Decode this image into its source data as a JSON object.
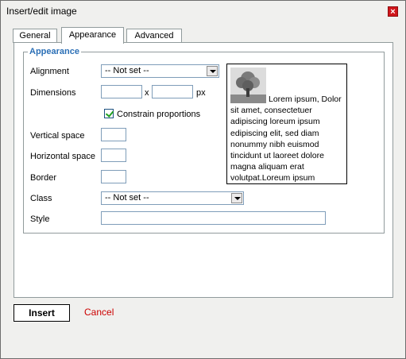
{
  "window": {
    "title": "Insert/edit image",
    "close_label": "×"
  },
  "tabs": [
    {
      "label": "General"
    },
    {
      "label": "Appearance"
    },
    {
      "label": "Advanced"
    }
  ],
  "appearance": {
    "legend": "Appearance",
    "alignment": {
      "label": "Alignment",
      "value": "-- Not set --"
    },
    "dimensions": {
      "label": "Dimensions",
      "width": "",
      "height": "",
      "separator": "x",
      "unit": "px"
    },
    "constrain": {
      "label": "Constrain proportions",
      "checked": true
    },
    "vspace": {
      "label": "Vertical space",
      "value": ""
    },
    "hspace": {
      "label": "Horizontal space",
      "value": ""
    },
    "border": {
      "label": "Border",
      "value": ""
    },
    "class": {
      "label": "Class",
      "value": "-- Not set --"
    },
    "style": {
      "label": "Style",
      "value": ""
    },
    "preview_text": "Lorem ipsum, Dolor sit amet, consectetuer adipiscing loreum ipsum edipiscing elit, sed diam nonummy nibh euismod tincidunt ut laoreet dolore magna aliquam erat volutpat.Loreum ipsum"
  },
  "footer": {
    "insert_label": "Insert",
    "cancel_label": "Cancel"
  }
}
